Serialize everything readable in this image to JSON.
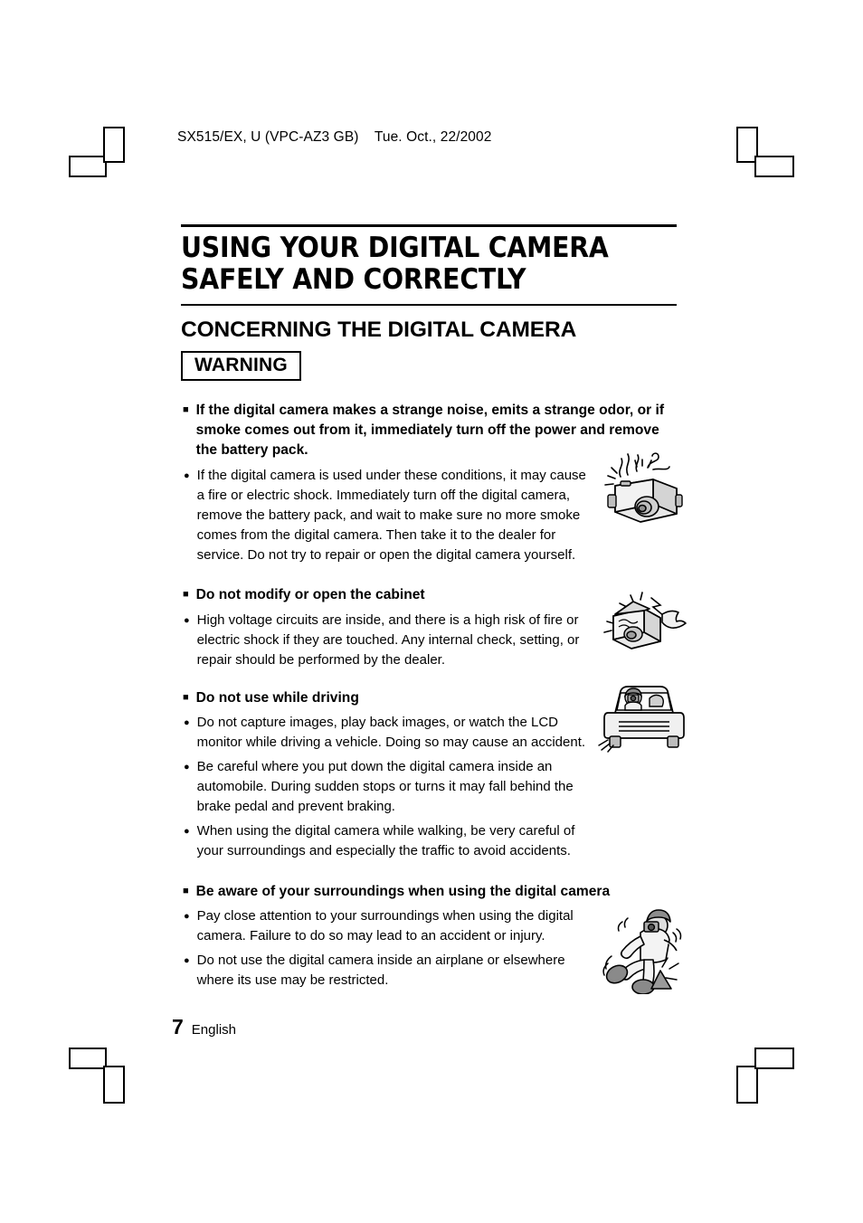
{
  "running_head": "SX515/EX, U (VPC-AZ3 GB)    Tue. Oct., 22/2002",
  "document": {
    "title": "USING YOUR DIGITAL CAMERA SAFELY AND CORRECTLY",
    "section_title": "CONCERNING THE DIGITAL CAMERA",
    "warning_label": "WARNING"
  },
  "markers": {
    "square_bullet": "■",
    "round_bullet": "●"
  },
  "items": [
    {
      "heading": "If the digital camera makes a strange noise, emits a strange odor, or if smoke comes out from it, immediately turn off the power and remove the battery pack.",
      "bullets": [
        "If the digital camera is used under these conditions, it may cause a fire or electric shock. Immediately turn off the digital camera, remove the battery pack, and wait to make sure no more smoke comes from the digital camera. Then take it to the dealer for service. Do not try to repair or open the digital camera yourself."
      ],
      "figure": "smoking-camera-illustration"
    },
    {
      "heading": "Do not modify or open the cabinet",
      "bullets": [
        "High voltage circuits are inside, and there is a high risk of fire or electric shock if they are touched. Any internal check, setting, or repair should be performed by the dealer."
      ],
      "figure": "opened-camera-shock-illustration"
    },
    {
      "heading": "Do not use while driving",
      "bullets": [
        "Do not capture images, play back images, or watch the LCD monitor while driving a vehicle. Doing so may cause an accident.",
        "Be careful where you put down the digital camera inside an automobile. During sudden stops or turns it may fall behind the brake pedal and prevent braking.",
        "When using the digital camera while walking, be very careful of your surroundings and especially the traffic to avoid accidents."
      ],
      "figure": "driver-with-camera-illustration"
    },
    {
      "heading": "Be aware of your surroundings when using the digital camera",
      "bullets": [
        "Pay close attention to your surroundings when using the digital camera. Failure to do so may lead to an accident or injury.",
        "Do not use the digital camera inside an airplane or elsewhere where its use may be restricted."
      ],
      "figure": "person-tripping-illustration"
    }
  ],
  "footer": {
    "page_number": "7",
    "language": "English"
  }
}
